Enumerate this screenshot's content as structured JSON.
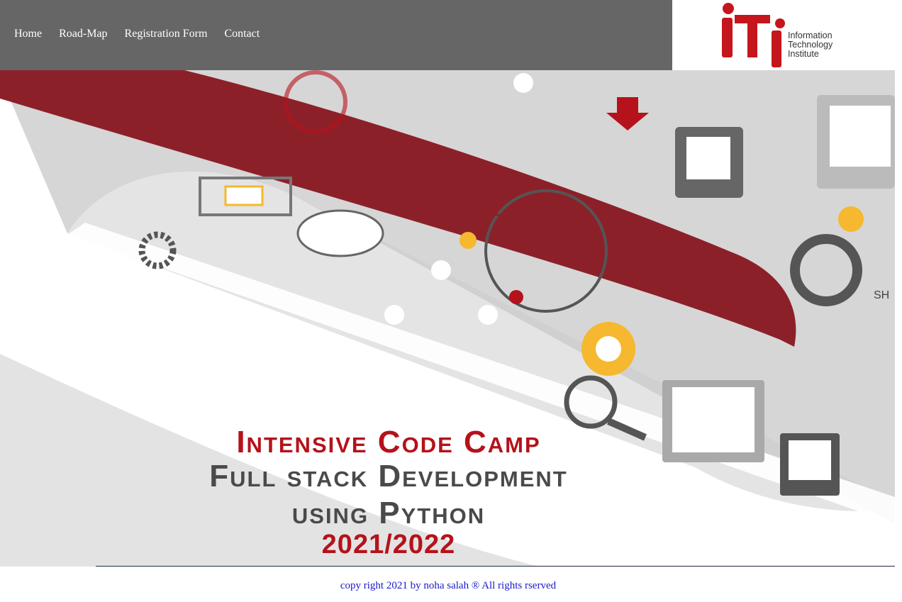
{
  "nav": {
    "items": [
      {
        "label": "Home"
      },
      {
        "label": "Road-Map"
      },
      {
        "label": "Registration Form"
      },
      {
        "label": "Contact"
      }
    ]
  },
  "logo": {
    "line1": "Information",
    "line2": "Technology",
    "line3": "Institute",
    "brand_color": "#c4161c"
  },
  "banner": {
    "line1": "Intensive Code Camp",
    "line2": "Full stack Development",
    "line3": "using Python",
    "line4": "2021/2022",
    "accent": "#b5121b",
    "icon_fragment": "SH"
  },
  "footer": {
    "text": "copy right 2021 by noha salah ® All rights rserved"
  }
}
